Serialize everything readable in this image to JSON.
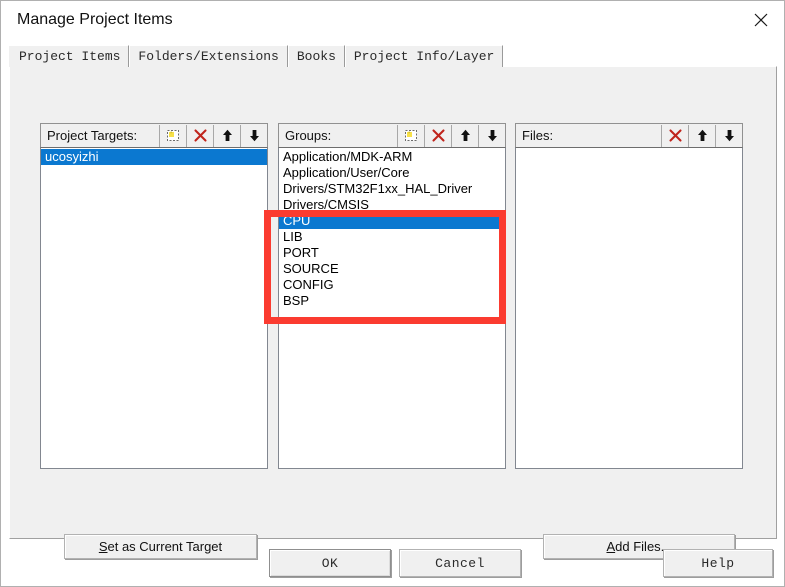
{
  "window": {
    "title": "Manage Project Items",
    "close_icon": "close-icon"
  },
  "tabs": [
    {
      "label": "Project Items",
      "active": true
    },
    {
      "label": "Folders/Extensions",
      "active": false
    },
    {
      "label": "Books",
      "active": false
    },
    {
      "label": "Project Info/Layer",
      "active": false
    }
  ],
  "panels": {
    "targets": {
      "label": "Project Targets:",
      "tools": [
        "new-item-icon",
        "delete-icon",
        "move-up-icon",
        "move-down-icon"
      ],
      "items": [
        {
          "label": "ucosyizhi",
          "selected": true
        }
      ]
    },
    "groups": {
      "label": "Groups:",
      "tools": [
        "new-item-icon",
        "delete-icon",
        "move-up-icon",
        "move-down-icon"
      ],
      "items": [
        {
          "label": "Application/MDK-ARM",
          "selected": false
        },
        {
          "label": "Application/User/Core",
          "selected": false
        },
        {
          "label": "Drivers/STM32F1xx_HAL_Driver",
          "selected": false
        },
        {
          "label": "Drivers/CMSIS",
          "selected": false
        },
        {
          "label": "CPU",
          "selected": true
        },
        {
          "label": "LIB",
          "selected": false
        },
        {
          "label": "PORT",
          "selected": false
        },
        {
          "label": "SOURCE",
          "selected": false
        },
        {
          "label": "CONFIG",
          "selected": false
        },
        {
          "label": "BSP",
          "selected": false
        }
      ]
    },
    "files": {
      "label": "Files:",
      "tools": [
        "delete-icon",
        "move-up-icon",
        "move-down-icon"
      ],
      "items": []
    }
  },
  "buttons": {
    "set_target": {
      "accel": "S",
      "rest": "et as Current Target"
    },
    "add_files": {
      "accel": "A",
      "rest": "dd Files..."
    },
    "ok": "OK",
    "cancel": "Cancel",
    "help": "Help"
  },
  "annotation": {
    "type": "highlight-rectangle",
    "color": "#fb3b30"
  },
  "colors": {
    "selection_blue": "#0b78d0",
    "dialog_face": "#f0f0f0",
    "annotation_red": "#fb3b30"
  }
}
